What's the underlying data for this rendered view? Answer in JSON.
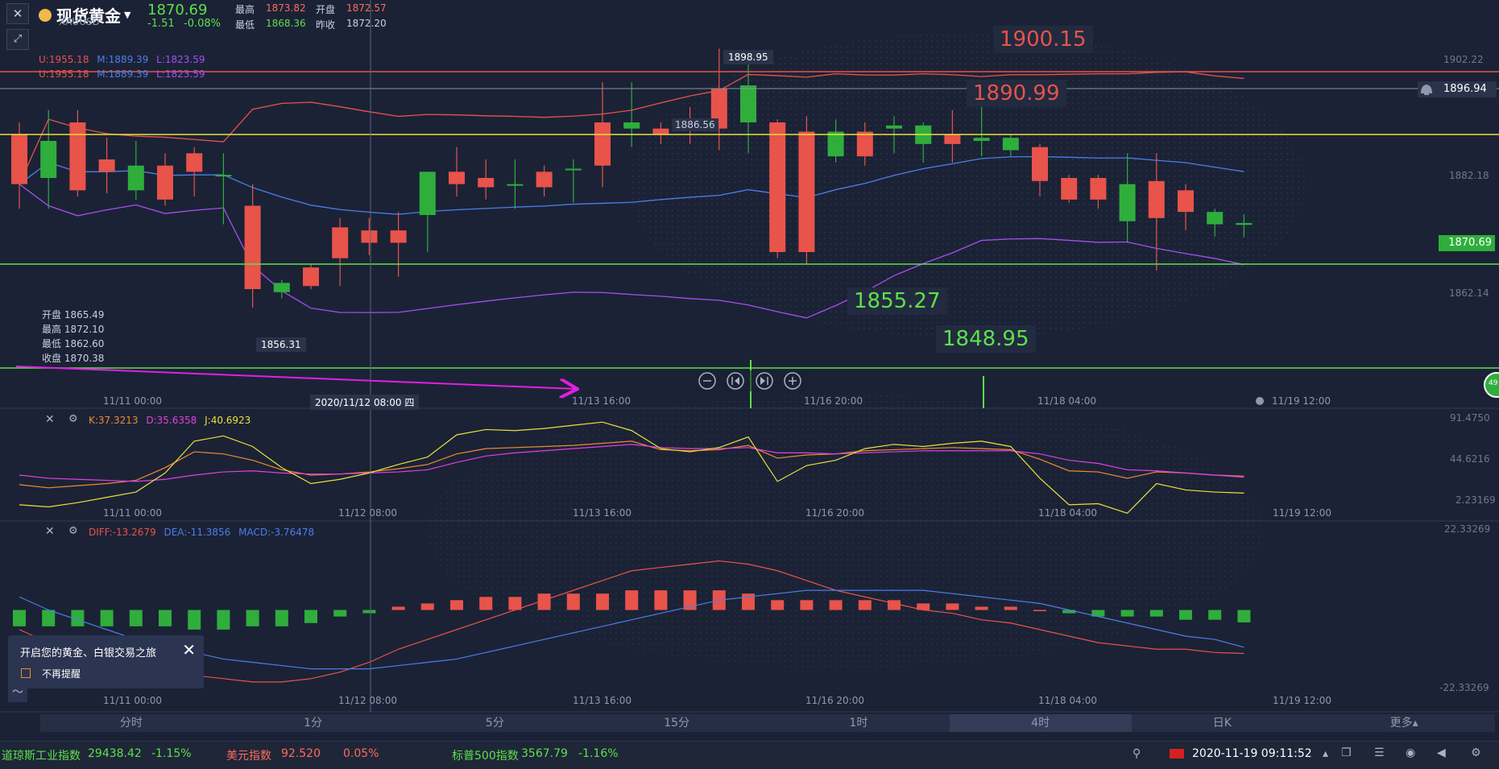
{
  "header": {
    "symbol_name": "现货黄金",
    "symbol_code": "XAUUSD",
    "price": "1870.69",
    "change": "-1.51",
    "change_pct": "-0.08%",
    "high_label": "最高",
    "high": "1873.82",
    "low_label": "最低",
    "low": "1868.36",
    "open_label": "开盘",
    "open": "1872.57",
    "prev_close_label": "昨收",
    "prev_close": "1872.20"
  },
  "boll": {
    "upper": "U:1955.18",
    "mid": "M:1889.39",
    "lower": "L:1823.59"
  },
  "main_chart": {
    "y_ticks": [
      "1902.22",
      "1882.18",
      "1862.14"
    ],
    "current_price_tag": "1870.69",
    "alert_price_tag": "1896.94",
    "label_max": "1898.95",
    "label_min": "1856.31",
    "label_mid": "1886.56",
    "annotation_1900": "1900.15",
    "annotation_1890": "1890.99",
    "annotation_1855": "1855.27",
    "annotation_1848": "1848.95",
    "crosshair_time": "2020/11/12 08:00 四",
    "side_badge": "49",
    "info": {
      "open": "开盘 1865.49",
      "high": "最高 1872.10",
      "low": "最低 1862.60",
      "close": "收盘 1870.38"
    },
    "x_ticks": [
      "11/11 00:00",
      "11/13 16:00",
      "11/16 20:00",
      "11/18 04:00",
      "11/19 12:00"
    ],
    "colors": {
      "up": "#2fae3c",
      "down": "#e8534a",
      "upper": "#e8534a",
      "mid": "#4a7fe6",
      "lower": "#a64ff0"
    }
  },
  "chart_data": [
    {
      "type": "candlestick",
      "title": "现货黄金 XAUUSD 4时",
      "candles": [
        {
          "o": 1885.0,
          "h": 1887.0,
          "l": 1873.0,
          "c": 1877.0
        },
        {
          "o": 1878.0,
          "h": 1889.0,
          "l": 1873.0,
          "c": 1884.0
        },
        {
          "o": 1887.0,
          "h": 1889.0,
          "l": 1875.0,
          "c": 1876.0
        },
        {
          "o": 1881.0,
          "h": 1884.5,
          "l": 1875.5,
          "c": 1879.0
        },
        {
          "o": 1876.0,
          "h": 1884.0,
          "l": 1874.5,
          "c": 1880.0
        },
        {
          "o": 1880.0,
          "h": 1882.0,
          "l": 1873.5,
          "c": 1874.5
        },
        {
          "o": 1882.0,
          "h": 1883.0,
          "l": 1875.0,
          "c": 1879.0
        },
        {
          "o": 1878.5,
          "h": 1882.0,
          "l": 1870.5,
          "c": 1878.5
        },
        {
          "o": 1873.5,
          "h": 1877.0,
          "l": 1857.0,
          "c": 1860.0
        },
        {
          "o": 1859.5,
          "h": 1861.5,
          "l": 1858.5,
          "c": 1861.0
        },
        {
          "o": 1863.5,
          "h": 1864.0,
          "l": 1860.0,
          "c": 1860.5
        },
        {
          "o": 1870.0,
          "h": 1871.5,
          "l": 1860.5,
          "c": 1865.0
        },
        {
          "o": 1869.5,
          "h": 1871.5,
          "l": 1865.5,
          "c": 1867.5
        },
        {
          "o": 1869.5,
          "h": 1872.5,
          "l": 1862.0,
          "c": 1867.5
        },
        {
          "o": 1872.0,
          "h": 1879.0,
          "l": 1866.0,
          "c": 1879.0
        },
        {
          "o": 1879.0,
          "h": 1883.0,
          "l": 1875.0,
          "c": 1877.0
        },
        {
          "o": 1878.0,
          "h": 1881.0,
          "l": 1874.5,
          "c": 1876.5
        },
        {
          "o": 1877.0,
          "h": 1881.0,
          "l": 1873.0,
          "c": 1877.0
        },
        {
          "o": 1879.0,
          "h": 1880.0,
          "l": 1875.0,
          "c": 1876.5
        },
        {
          "o": 1879.5,
          "h": 1881.0,
          "l": 1874.0,
          "c": 1879.5
        },
        {
          "o": 1887.0,
          "h": 1893.5,
          "l": 1876.5,
          "c": 1880.0
        },
        {
          "o": 1886.0,
          "h": 1893.5,
          "l": 1883.0,
          "c": 1887.0
        },
        {
          "o": 1886.0,
          "h": 1887.0,
          "l": 1883.5,
          "c": 1885.0
        },
        {
          "o": 1887.5,
          "h": 1889.5,
          "l": 1883.5,
          "c": 1886.5
        },
        {
          "o": 1892.5,
          "h": 1898.95,
          "l": 1882.5,
          "c": 1886.0
        },
        {
          "o": 1887.0,
          "h": 1896.5,
          "l": 1882.0,
          "c": 1893.0
        },
        {
          "o": 1887.0,
          "h": 1887.5,
          "l": 1865.0,
          "c": 1866.0
        },
        {
          "o": 1885.5,
          "h": 1888.0,
          "l": 1864.0,
          "c": 1866.0
        },
        {
          "o": 1881.5,
          "h": 1887.5,
          "l": 1880.5,
          "c": 1885.5
        },
        {
          "o": 1885.5,
          "h": 1887.0,
          "l": 1880.0,
          "c": 1881.5
        },
        {
          "o": 1886.0,
          "h": 1888.0,
          "l": 1882.0,
          "c": 1886.5
        },
        {
          "o": 1883.5,
          "h": 1887.0,
          "l": 1880.5,
          "c": 1886.5
        },
        {
          "o": 1885.0,
          "h": 1889.0,
          "l": 1880.5,
          "c": 1883.5
        },
        {
          "o": 1884.0,
          "h": 1890.0,
          "l": 1881.5,
          "c": 1884.5
        },
        {
          "o": 1882.5,
          "h": 1885.0,
          "l": 1881.5,
          "c": 1884.5
        },
        {
          "o": 1883.0,
          "h": 1883.5,
          "l": 1875.0,
          "c": 1877.5
        },
        {
          "o": 1878.0,
          "h": 1878.5,
          "l": 1874.0,
          "c": 1874.5
        },
        {
          "o": 1878.0,
          "h": 1878.5,
          "l": 1873.0,
          "c": 1874.5
        },
        {
          "o": 1871.0,
          "h": 1882.0,
          "l": 1867.5,
          "c": 1877.0
        },
        {
          "o": 1877.5,
          "h": 1882.0,
          "l": 1863.0,
          "c": 1871.5
        },
        {
          "o": 1876.0,
          "h": 1877.0,
          "l": 1869.5,
          "c": 1872.5
        },
        {
          "o": 1870.5,
          "h": 1873.0,
          "l": 1868.5,
          "c": 1872.5
        },
        {
          "o": 1870.4,
          "h": 1872.1,
          "l": 1868.4,
          "c": 1870.7
        }
      ],
      "ylim": [
        1845.0,
        1905.0
      ]
    },
    {
      "type": "line",
      "title": "KDJ",
      "series": [
        {
          "name": "K:37.3213",
          "values": [
            29,
            26,
            28,
            30,
            33,
            45,
            60,
            58,
            52,
            43,
            38,
            39,
            41,
            44,
            48,
            58,
            63,
            64,
            65,
            66,
            68,
            70,
            62,
            61,
            62,
            66,
            54,
            57,
            58,
            61,
            62,
            63,
            64,
            63,
            62,
            53,
            42,
            41,
            35,
            41,
            40,
            38,
            37
          ]
        },
        {
          "name": "D:35.6358",
          "values": [
            38,
            35,
            34,
            33,
            32,
            34,
            38,
            41,
            42,
            40,
            39,
            39,
            40,
            41,
            43,
            50,
            56,
            59,
            61,
            63,
            65,
            67,
            64,
            63,
            63,
            64,
            59,
            59,
            58,
            59,
            60,
            61,
            61,
            61,
            61,
            58,
            52,
            49,
            43,
            42,
            40,
            38,
            36
          ]
        },
        {
          "name": "J:40.6923",
          "values": [
            10,
            8,
            12,
            17,
            22,
            40,
            70,
            75,
            65,
            45,
            30,
            34,
            40,
            48,
            55,
            76,
            81,
            80,
            82,
            85,
            88,
            80,
            63,
            60,
            64,
            74,
            32,
            47,
            52,
            63,
            67,
            65,
            68,
            70,
            65,
            35,
            10,
            11,
            2,
            30,
            24,
            22,
            21
          ]
        }
      ],
      "y_ticks": [
        "91.4750",
        "44.6216",
        "2.23169"
      ],
      "ylim": [
        0,
        95
      ]
    },
    {
      "type": "bar",
      "title": "MACD",
      "series": [
        {
          "name": "DIFF:-13.2679",
          "values": [
            -6,
            -10,
            -13,
            -15,
            -17,
            -19,
            -20,
            -21,
            -22,
            -22,
            -21,
            -19,
            -16,
            -12,
            -9,
            -6,
            -3,
            0,
            3,
            6,
            9,
            12,
            13,
            14,
            15,
            14,
            12,
            9,
            6,
            4,
            2,
            0,
            -1,
            -3,
            -4,
            -6,
            -8,
            -10,
            -11,
            -12,
            -12,
            -13,
            -13.3
          ]
        },
        {
          "name": "DEA:-11.3856",
          "values": [
            4,
            0,
            -3,
            -6,
            -9,
            -11,
            -13,
            -15,
            -16,
            -17,
            -18,
            -18,
            -18,
            -17,
            -16,
            -15,
            -13,
            -11,
            -9,
            -7,
            -5,
            -3,
            -1,
            1,
            3,
            4,
            5,
            6,
            6,
            6,
            6,
            6,
            5,
            4,
            3,
            2,
            0,
            -2,
            -4,
            -6,
            -8,
            -9,
            -11.4
          ]
        },
        {
          "name": "MACD:-3.76478",
          "values": [
            -5,
            -5,
            -5,
            -5,
            -5,
            -5,
            -6,
            -6,
            -5,
            -5,
            -4,
            -2,
            -1,
            1,
            2,
            3,
            4,
            4,
            5,
            5,
            5,
            6,
            6,
            6,
            6,
            5,
            3,
            3,
            3,
            3,
            3,
            2,
            2,
            1,
            1,
            0,
            -1,
            -2,
            -2,
            -2,
            -3,
            -3,
            -3.8
          ]
        }
      ],
      "y_ticks": [
        "22.33269",
        "-22.33269"
      ],
      "ylim": [
        -24,
        24
      ]
    }
  ],
  "kdj_labels": {
    "k": "K:37.3213",
    "d": "D:35.6358",
    "j": "J:40.6923"
  },
  "macd_labels": {
    "diff": "DIFF:-13.2679",
    "dea": "DEA:-11.3856",
    "macd": "MACD:-3.76478"
  },
  "sub_x_ticks": [
    "11/11 00:00",
    "11/12 08:00",
    "11/13 16:00",
    "11/16 20:00",
    "11/18 04:00",
    "11/19 12:00"
  ],
  "timeframes": [
    {
      "label": "分时",
      "active": false
    },
    {
      "label": "1分",
      "active": false
    },
    {
      "label": "5分",
      "active": false
    },
    {
      "label": "15分",
      "active": false
    },
    {
      "label": "1时",
      "active": false
    },
    {
      "label": "4时",
      "active": true
    },
    {
      "label": "日K",
      "active": false
    },
    {
      "label": "更多▴",
      "active": false
    }
  ],
  "popup": {
    "title": "开启您的黄金、白银交易之旅",
    "checkbox_label": "不再提醒"
  },
  "ticker": {
    "dow_name": "道琼斯工业指数",
    "dow_value": "29438.42",
    "dow_change": "-1.15%",
    "usd_name": "美元指数",
    "usd_value": "92.520",
    "usd_change": "0.05%",
    "sp_name": "标普500指数",
    "sp_value": "3567.79",
    "sp_change": "-1.16%",
    "datetime": "2020-11-19 09:11:52"
  }
}
